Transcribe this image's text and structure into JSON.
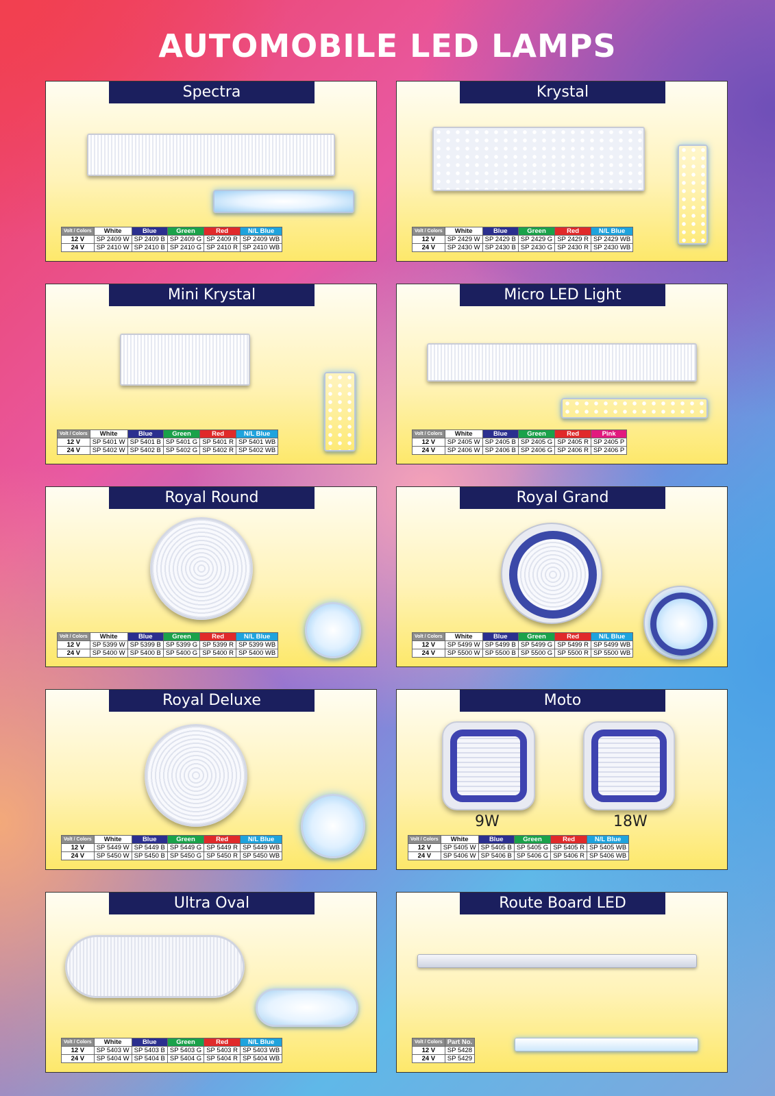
{
  "page_title": "AUTOMOBILE LED LAMPS",
  "color_headers": {
    "volt": "Volt / Colors",
    "white": "White",
    "blue": "Blue",
    "green": "Green",
    "red": "Red",
    "nlblue": "N/L Blue",
    "pink": "Pink",
    "part": "Part No."
  },
  "volts": {
    "v12": "12 V",
    "v24": "24 V"
  },
  "products": {
    "spectra": {
      "name": "Spectra",
      "r12": [
        "SP 2409 W",
        "SP 2409 B",
        "SP 2409 G",
        "SP 2409 R",
        "SP 2409 WB"
      ],
      "r24": [
        "SP 2410 W",
        "SP 2410 B",
        "SP 2410 G",
        "SP 2410 R",
        "SP 2410 WB"
      ]
    },
    "krystal": {
      "name": "Krystal",
      "r12": [
        "SP 2429 W",
        "SP 2429 B",
        "SP 2429 G",
        "SP 2429 R",
        "SP 2429 WB"
      ],
      "r24": [
        "SP 2430 W",
        "SP 2430 B",
        "SP 2430 G",
        "SP 2430 R",
        "SP 2430 WB"
      ]
    },
    "mini_krystal": {
      "name": "Mini Krystal",
      "r12": [
        "SP 5401 W",
        "SP 5401 B",
        "SP 5401 G",
        "SP 5401 R",
        "SP 5401 WB"
      ],
      "r24": [
        "SP 5402 W",
        "SP 5402 B",
        "SP 5402 G",
        "SP 5402 R",
        "SP 5402 WB"
      ]
    },
    "micro_led": {
      "name": "Micro LED Light",
      "r12": [
        "SP 2405 W",
        "SP 2405 B",
        "SP 2405 G",
        "SP 2405 R",
        "SP 2405 P"
      ],
      "r24": [
        "SP 2406 W",
        "SP 2406 B",
        "SP 2406 G",
        "SP 2406 R",
        "SP 2406 P"
      ]
    },
    "royal_round": {
      "name": "Royal Round",
      "r12": [
        "SP 5399 W",
        "SP 5399 B",
        "SP 5399 G",
        "SP 5399 R",
        "SP 5399 WB"
      ],
      "r24": [
        "SP 5400 W",
        "SP 5400 B",
        "SP 5400 G",
        "SP 5400 R",
        "SP 5400 WB"
      ]
    },
    "royal_grand": {
      "name": "Royal Grand",
      "r12": [
        "SP 5499 W",
        "SP 5499 B",
        "SP 5499 G",
        "SP 5499 R",
        "SP 5499 WB"
      ],
      "r24": [
        "SP 5500 W",
        "SP 5500 B",
        "SP 5500 G",
        "SP 5500 R",
        "SP 5500 WB"
      ]
    },
    "royal_deluxe": {
      "name": "Royal Deluxe",
      "r12": [
        "SP 5449 W",
        "SP 5449 B",
        "SP 5449 G",
        "SP 5449 R",
        "SP 5449 WB"
      ],
      "r24": [
        "SP 5450 W",
        "SP 5450 B",
        "SP 5450 G",
        "SP 5450 R",
        "SP 5450 WB"
      ]
    },
    "moto": {
      "name": "Moto",
      "watt_a": "9W",
      "watt_b": "18W",
      "r12": [
        "SP 5405 W",
        "SP 5405 B",
        "SP 5405 G",
        "SP 5405 R",
        "SP 5405 WB"
      ],
      "r24": [
        "SP 5406 W",
        "SP 5406 B",
        "SP 5406 G",
        "SP 5406 R",
        "SP 5406 WB"
      ]
    },
    "ultra_oval": {
      "name": "Ultra Oval",
      "r12": [
        "SP 5403 W",
        "SP 5403 B",
        "SP 5403 G",
        "SP 5403 R",
        "SP 5403 WB"
      ],
      "r24": [
        "SP 5404 W",
        "SP 5404 B",
        "SP 5404 G",
        "SP 5404 R",
        "SP 5404 WB"
      ]
    },
    "route_board": {
      "name": "Route Board LED",
      "r12": [
        "SP 5428"
      ],
      "r24": [
        "SP 5429"
      ]
    }
  }
}
